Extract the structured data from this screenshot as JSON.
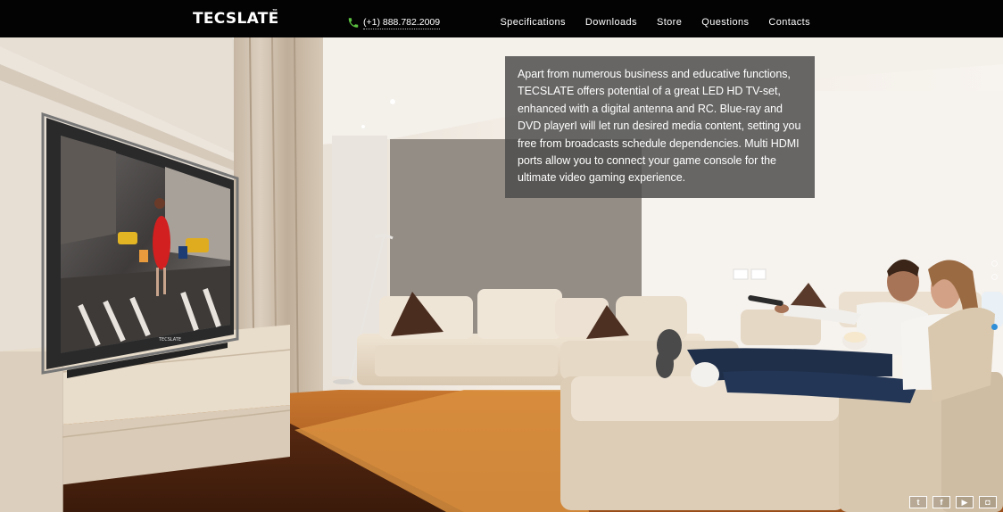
{
  "header": {
    "logo": "TECSLATE",
    "logo_tm": "™",
    "phone": "(+1) 888.782.2009",
    "nav": [
      "Specifications",
      "Downloads",
      "Store",
      "Questions",
      "Contacts"
    ]
  },
  "hero": {
    "description": "Apart from numerous business and educative functions, TECSLATE offers potential of a great LED HD TV-set, enhanced with a digital antenna and RC. Blue-ray and DVD playerI will let run desired media content, setting you free from broadcasts schedule dependencies. Multi HDMI ports allow you to connect your game console for the ultimate video gaming experience.",
    "tv_brand": "TECSLATE",
    "slider": {
      "total": 3,
      "active": 3
    }
  },
  "social": [
    "twitter",
    "facebook",
    "youtube",
    "instagram"
  ],
  "colors": {
    "phone_icon": "#5cc341",
    "active_dot": "#2e8fd8",
    "overlay": "#4b4b4b"
  }
}
